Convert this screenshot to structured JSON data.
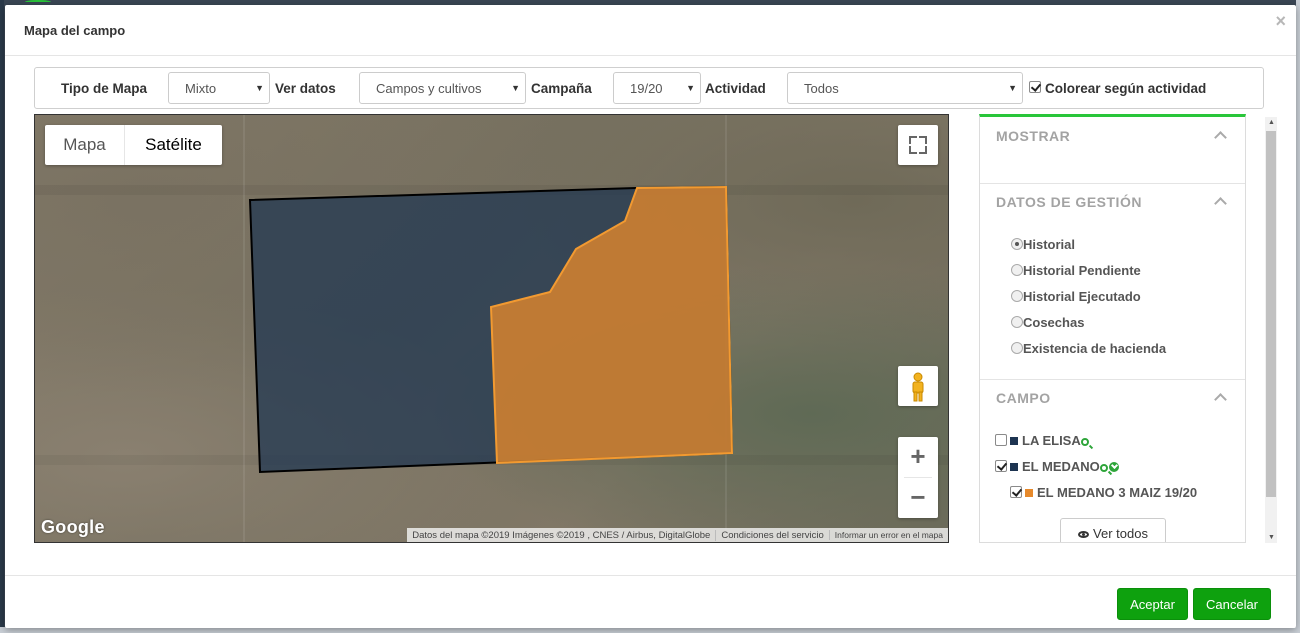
{
  "modal": {
    "title": "Mapa del campo",
    "close": "×"
  },
  "filters": {
    "tipo_mapa_label": "Tipo de Mapa",
    "tipo_mapa_value": "Mixto",
    "ver_datos_label": "Ver datos",
    "ver_datos_value": "Campos y cultivos",
    "campana_label": "Campaña",
    "campana_value": "19/20",
    "actividad_label": "Actividad",
    "actividad_value": "Todos",
    "colorear_label": "Colorear según actividad",
    "colorear_checked": true
  },
  "map": {
    "type_options": [
      "Mapa",
      "Satélite"
    ],
    "selected_type": "Satélite",
    "zoom_in": "+",
    "zoom_out": "−",
    "logo": "Google",
    "attribution": "Datos del mapa ©2019 Imágenes ©2019 , CNES / Airbus, DigitalGlobe",
    "terms": "Condiciones del servicio",
    "report": "Informar un error en el mapa",
    "field_colors": {
      "blue": "#233a55",
      "orange": "#e6892b"
    }
  },
  "panel": {
    "mostrar": "MOSTRAR",
    "datos_gestion": "DATOS DE GESTIÓN",
    "radio_options": [
      "Historial",
      "Historial Pendiente",
      "Historial Ejecutado",
      "Cosechas",
      "Existencia de hacienda"
    ],
    "selected_radio": "Historial",
    "campo": "CAMPO",
    "campos": [
      {
        "name": "LA ELISA",
        "checked": false,
        "color": "#1d3451"
      },
      {
        "name": "EL MEDANO",
        "checked": true,
        "color": "#1d3451"
      },
      {
        "name": "EL MEDANO 3 MAIZ 19/20",
        "checked": true,
        "color": "#e6892b"
      }
    ],
    "ver_todos": "Ver todos"
  },
  "footer": {
    "aceptar": "Aceptar",
    "cancelar": "Cancelar"
  },
  "accent": "#29c63a"
}
